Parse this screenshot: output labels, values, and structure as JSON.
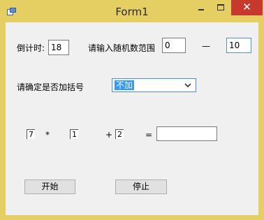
{
  "window": {
    "title": "Form1",
    "close_glyph": "✕"
  },
  "countdown": {
    "label": "倒计时:",
    "value": "18"
  },
  "range": {
    "label": "请输入随机数范围",
    "min_value": "0",
    "separator": "—",
    "max_value": "10"
  },
  "bracket": {
    "label": "请确定是否加括号",
    "selected": "不加"
  },
  "expression": {
    "a": "7",
    "op1": "*",
    "b": "1",
    "op2": "+",
    "c": "2",
    "equals": "=",
    "answer": ""
  },
  "buttons": {
    "start": "开始",
    "stop": "停止"
  }
}
